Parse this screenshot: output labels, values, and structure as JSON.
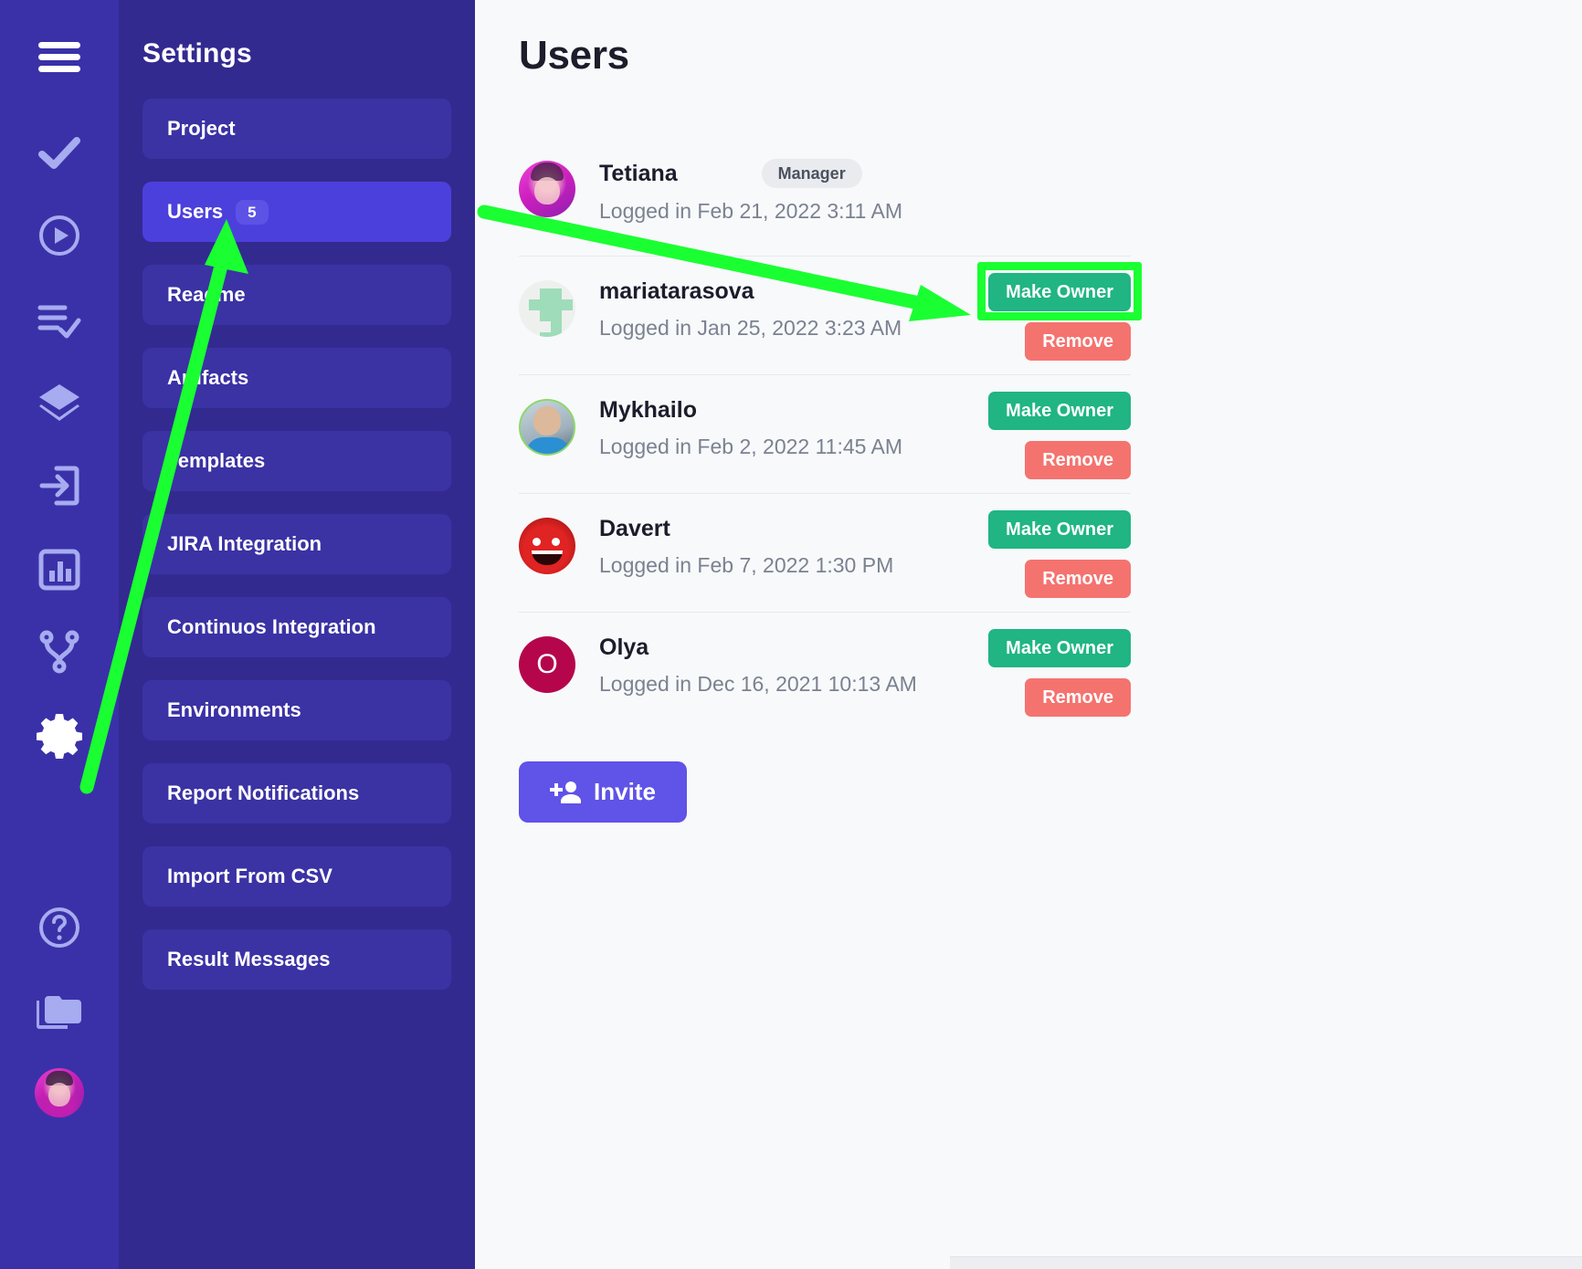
{
  "rail": {
    "icons": [
      {
        "name": "hamburger-menu-icon",
        "label": "Menu",
        "active": true
      },
      {
        "name": "check-icon",
        "label": "Tests",
        "active": false
      },
      {
        "name": "play-circle-icon",
        "label": "Runs",
        "active": false
      },
      {
        "name": "list-check-icon",
        "label": "Plans",
        "active": false
      },
      {
        "name": "layers-icon",
        "label": "Suites",
        "active": false
      },
      {
        "name": "login-box-icon",
        "label": "Import",
        "active": false
      },
      {
        "name": "bar-chart-icon",
        "label": "Analytics",
        "active": false
      },
      {
        "name": "git-branch-icon",
        "label": "Branches",
        "active": false
      },
      {
        "name": "gear-icon",
        "label": "Settings",
        "active": true
      },
      {
        "name": "help-circle-icon",
        "label": "Help",
        "active": false
      },
      {
        "name": "folder-icon",
        "label": "Projects",
        "active": false
      }
    ],
    "avatar_label": "Tetiana"
  },
  "settings": {
    "title": "Settings",
    "items": [
      {
        "label": "Project",
        "selected": false,
        "badge": null
      },
      {
        "label": "Users",
        "selected": true,
        "badge": "5"
      },
      {
        "label": "Readme",
        "selected": false,
        "badge": null
      },
      {
        "label": "Artifacts",
        "selected": false,
        "badge": null
      },
      {
        "label": "Templates",
        "selected": false,
        "badge": null
      },
      {
        "label": "JIRA Integration",
        "selected": false,
        "badge": null
      },
      {
        "label": "Continuos Integration",
        "selected": false,
        "badge": null
      },
      {
        "label": "Environments",
        "selected": false,
        "badge": null
      },
      {
        "label": "Report Notifications",
        "selected": false,
        "badge": null
      },
      {
        "label": "Import From CSV",
        "selected": false,
        "badge": null
      },
      {
        "label": "Result Messages",
        "selected": false,
        "badge": null
      }
    ]
  },
  "main": {
    "page_title": "Users",
    "make_owner_label": "Make Owner",
    "remove_label": "Remove",
    "invite_label": "Invite",
    "invite_icon": "person-add-icon",
    "users": [
      {
        "name": "Tetiana",
        "login": "Logged in Feb 21, 2022 3:11 AM",
        "role": "Manager",
        "avatar_kind": "photo-pink",
        "avatar_initial": "",
        "has_actions": false,
        "highlighted": false
      },
      {
        "name": "mariatarasova",
        "login": "Logged in Jan 25, 2022 3:23 AM",
        "role": null,
        "avatar_kind": "identicon",
        "avatar_initial": "",
        "has_actions": true,
        "highlighted": true
      },
      {
        "name": "Mykhailo",
        "login": "Logged in Feb 2, 2022 11:45 AM",
        "role": null,
        "avatar_kind": "photo-man",
        "avatar_initial": "",
        "has_actions": true,
        "highlighted": false
      },
      {
        "name": "Davert",
        "login": "Logged in Feb 7, 2022 1:30 PM",
        "role": null,
        "avatar_kind": "photo-red",
        "avatar_initial": "",
        "has_actions": true,
        "highlighted": false
      },
      {
        "name": "Olya",
        "login": "Logged in Dec 16, 2021 10:13 AM",
        "role": null,
        "avatar_kind": "letter",
        "avatar_initial": "O",
        "has_actions": true,
        "highlighted": false
      }
    ]
  },
  "annotations": {
    "arrow_color": "#1aff32",
    "highlight_color": "#1aff32",
    "arrow_from": "users-menu-item",
    "arrow_to": "make-owner-button"
  },
  "colors": {
    "rail_bg": "#3a31a8",
    "settings_bg": "#332a90",
    "menu_item_bg": "#3b32a4",
    "menu_item_selected_bg": "#4c40dd",
    "main_bg": "#f8f9fb",
    "owner_green": "#20b583",
    "remove_red": "#f4736f",
    "invite_purple": "#5f53e8"
  }
}
